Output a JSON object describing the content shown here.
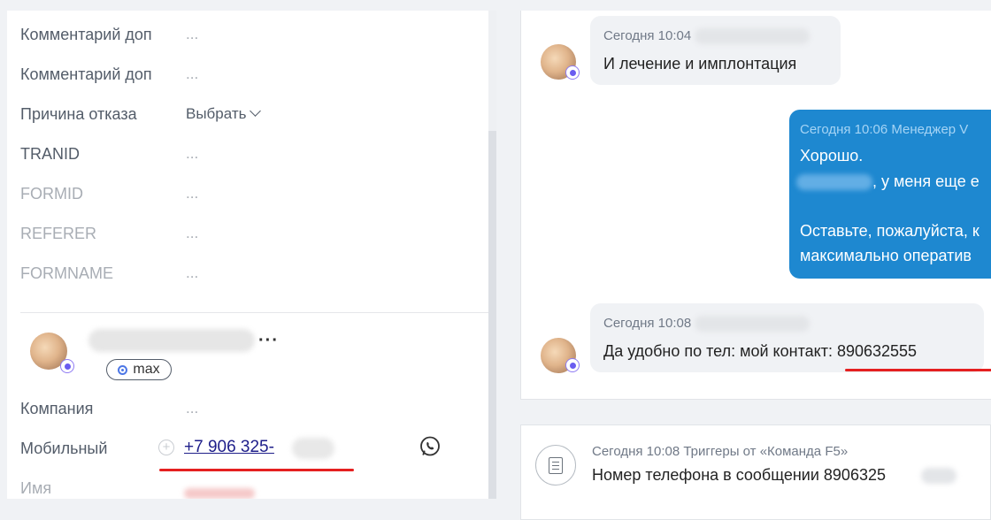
{
  "left": {
    "fields": [
      {
        "label": "Комментарий доп",
        "value": "..."
      },
      {
        "label": "Комментарий доп",
        "value": "..."
      },
      {
        "label": "Причина отказа",
        "value": "Выбрать"
      },
      {
        "label": "TRANID",
        "value": "..."
      },
      {
        "label": "FORMID",
        "value": "..."
      },
      {
        "label": "REFERER",
        "value": "..."
      },
      {
        "label": "FORMNAME",
        "value": "..."
      }
    ],
    "contact": {
      "more": "···",
      "tag": "max",
      "company_label": "Компания",
      "company_value": "...",
      "mobile_label": "Мобильный",
      "plus": "+",
      "phone": "+7 906 325-",
      "name_label": "Имя"
    }
  },
  "chat": {
    "messages": [
      {
        "meta": "Сегодня 10:04",
        "text": "И лечение и имплонтация"
      },
      {
        "meta": "Сегодня 10:06 Менеджер V",
        "lines": [
          "Хорошо.",
          ", у меня еще е",
          "Оставьте, пожалуйста, к",
          "максимально оператив"
        ]
      },
      {
        "meta": "Сегодня 10:08",
        "text": "Да удобно по тел: мой контакт: 890632555"
      }
    ],
    "trigger": {
      "meta": "Сегодня 10:08 Триггеры от «Команда F5»",
      "text": "Номер телефона в сообщении 8906325"
    }
  },
  "colors": {
    "accent": "#1e88d0",
    "underline_red": "#e52020",
    "badge": "#6a5cf0"
  },
  "icons": [
    "chevron-down-icon",
    "whatsapp-icon",
    "document-icon",
    "max-messenger-icon"
  ]
}
